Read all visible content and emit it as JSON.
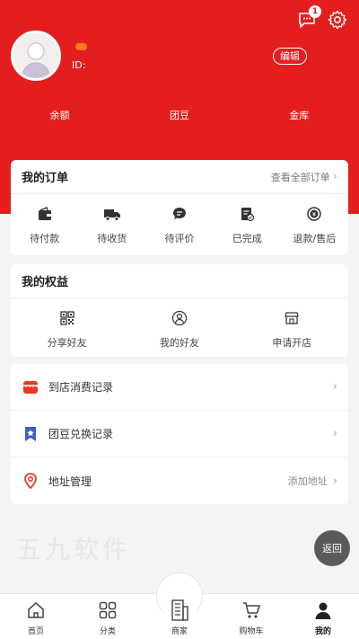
{
  "header": {
    "id_label": "ID:",
    "edit_label": "编辑",
    "message_count": "1",
    "assets": [
      {
        "label": "余额"
      },
      {
        "label": "团豆"
      },
      {
        "label": "金库"
      }
    ]
  },
  "orders": {
    "title": "我的订单",
    "more": "查看全部订单",
    "items": [
      {
        "label": "待付款",
        "icon": "wallet-icon"
      },
      {
        "label": "待收货",
        "icon": "truck-icon"
      },
      {
        "label": "待评价",
        "icon": "comment-icon"
      },
      {
        "label": "已完成",
        "icon": "clipboard-check-icon"
      },
      {
        "label": "退款/售后",
        "icon": "refund-icon"
      }
    ]
  },
  "benefits": {
    "title": "我的权益",
    "items": [
      {
        "label": "分享好友",
        "icon": "qr-code-icon"
      },
      {
        "label": "我的好友",
        "icon": "friends-icon"
      },
      {
        "label": "申请开店",
        "icon": "store-icon"
      }
    ]
  },
  "records": [
    {
      "label": "到店消费记录",
      "right": "",
      "icon": "shop-icon"
    },
    {
      "label": "团豆兑换记录",
      "right": "",
      "icon": "bookmark-star-icon"
    },
    {
      "label": "地址管理",
      "right": "添加地址",
      "icon": "location-pin-icon"
    }
  ],
  "watermark": "五九软件",
  "back_label": "返回",
  "tabs": [
    {
      "label": "首页",
      "icon": "home-icon"
    },
    {
      "label": "分类",
      "icon": "category-icon"
    },
    {
      "label": "商家",
      "icon": "building-icon"
    },
    {
      "label": "购物车",
      "icon": "cart-icon"
    },
    {
      "label": "我的",
      "icon": "user-icon"
    }
  ],
  "colors": {
    "brand_red": "#e41e1e",
    "tag_orange": "#ff7a1a"
  }
}
